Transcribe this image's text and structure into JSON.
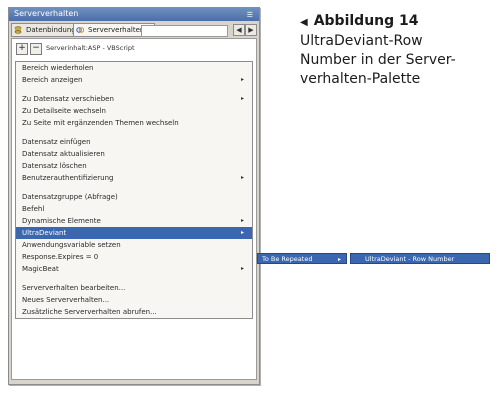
{
  "panel": {
    "title": "Serververhalten",
    "tabs": [
      {
        "label": "Datenbindungen",
        "icon": "database-icon"
      },
      {
        "label": "Serververhalten",
        "icon": "server-behavior-icon"
      }
    ],
    "toolbar": {
      "add_label": "+",
      "remove_label": "−",
      "document_type": "Serverinhalt:ASP - VBScript"
    }
  },
  "menu": {
    "groups": [
      [
        {
          "label": "Bereich wiederholen"
        },
        {
          "label": "Bereich anzeigen",
          "submenu": true
        }
      ],
      [
        {
          "label": "Zu Datensatz verschieben",
          "submenu": true
        },
        {
          "label": "Zu Detailseite wechseln"
        },
        {
          "label": "Zu Seite mit ergänzenden Themen wechseln"
        }
      ],
      [
        {
          "label": "Datensatz einfügen"
        },
        {
          "label": "Datensatz aktualisieren"
        },
        {
          "label": "Datensatz löschen"
        },
        {
          "label": "Benutzerauthentifizierung",
          "submenu": true
        }
      ],
      [
        {
          "label": "Datensatzgruppe (Abfrage)"
        },
        {
          "label": "Befehl"
        },
        {
          "label": "Dynamische Elemente",
          "submenu": true
        },
        {
          "label": "UltraDeviant",
          "submenu": true,
          "selected": true
        },
        {
          "label": "Anwendungsvariable setzen"
        },
        {
          "label": "Response.Expires = 0"
        },
        {
          "label": "MagicBeat",
          "submenu": true
        }
      ],
      [
        {
          "label": "Serververhalten bearbeiten..."
        },
        {
          "label": "Neues Serververhalten..."
        },
        {
          "label": "Zusätzliche Serververhalten abrufen..."
        }
      ]
    ],
    "submenu_arrow": "▸"
  },
  "submenu_level1": {
    "label": "To Be Repeated",
    "arrow": "▸"
  },
  "submenu_level2": {
    "label": "UltraDeviant - Row Number"
  },
  "caption": {
    "heading": "Abbildung 14",
    "lines": [
      "UltraDeviant-Row",
      "Number in der Server-",
      "verhalten-Palette"
    ]
  },
  "colors": {
    "selection": "#3a67b0",
    "panel_bg": "#d8d4cb",
    "titlebar": "#4a6ea8"
  }
}
